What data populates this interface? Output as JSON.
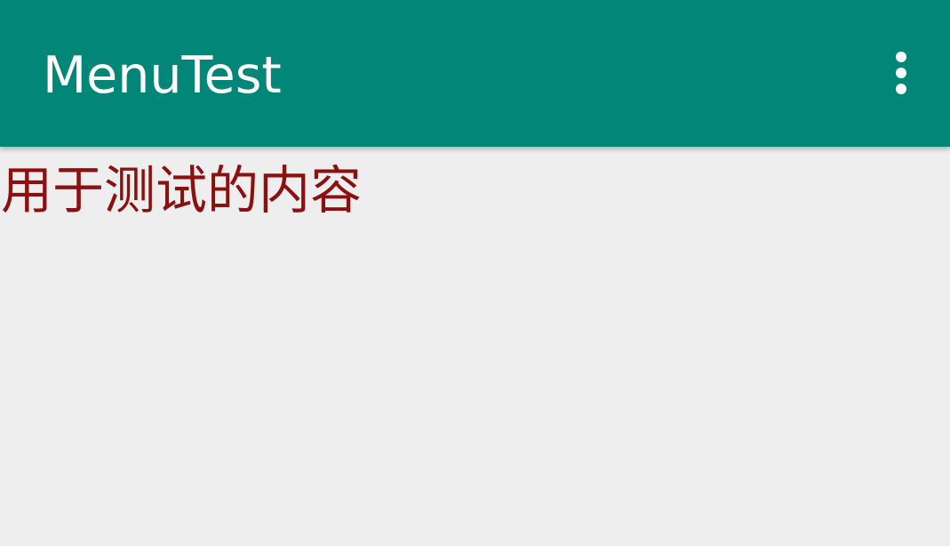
{
  "toolbar": {
    "title": "MenuTest",
    "overflow_icon": "more-vert-icon",
    "background_color": "#028678",
    "title_color": "#ffffff"
  },
  "content": {
    "text": "用于测试的内容",
    "text_color": "#8b1111",
    "background_color": "#eeeeee"
  }
}
